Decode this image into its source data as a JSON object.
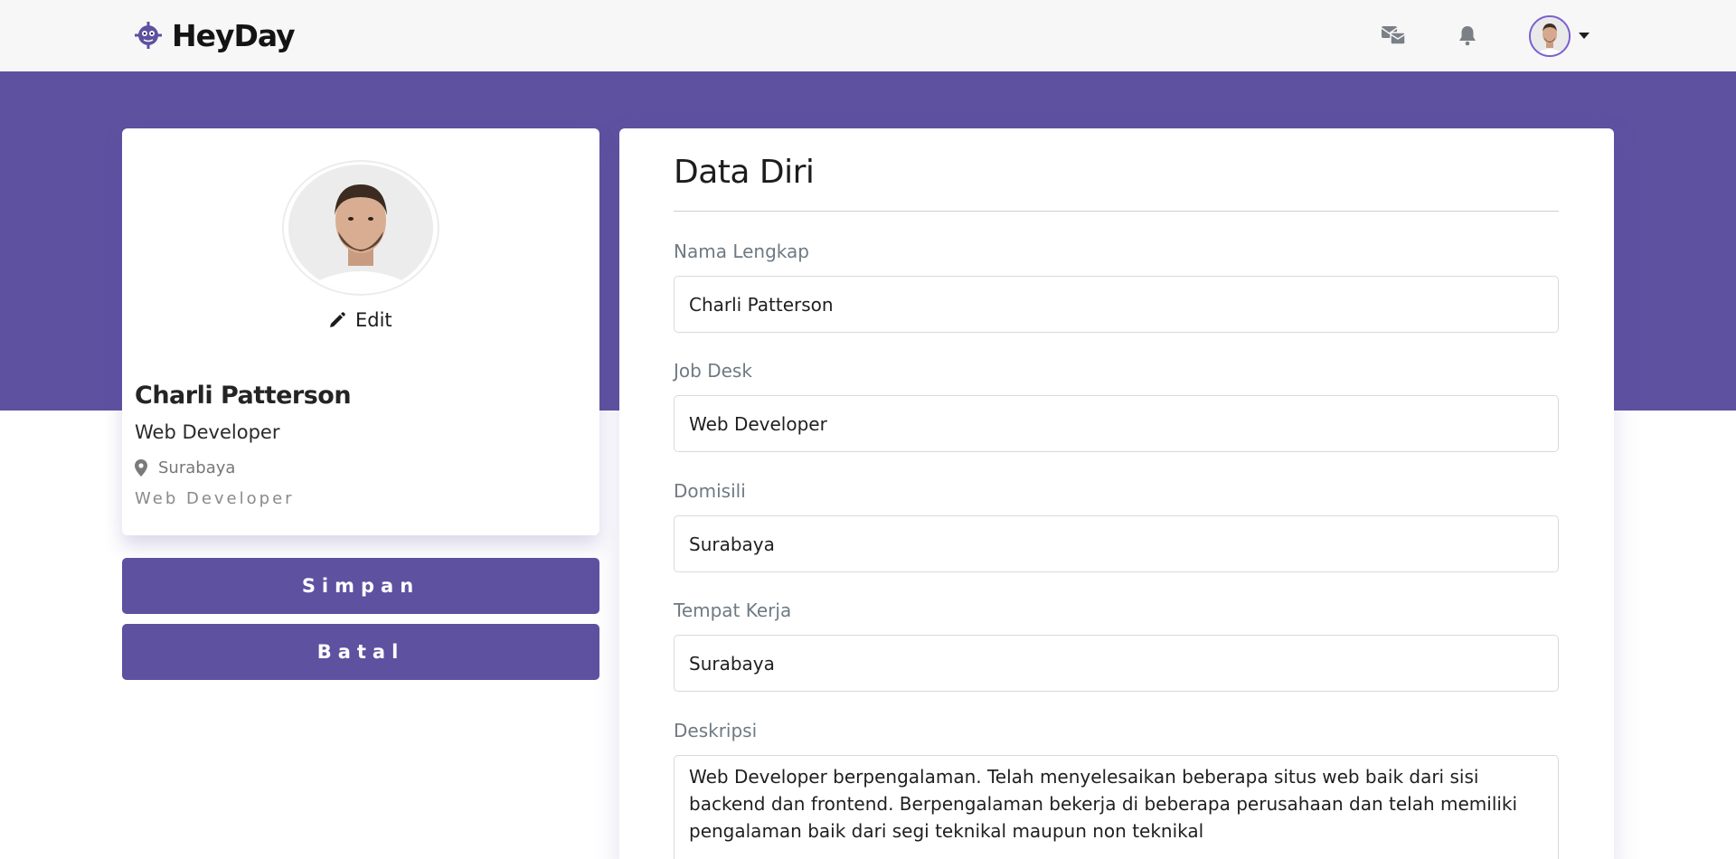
{
  "app": {
    "brand_name": "HeyDay"
  },
  "navbar": {
    "icons": [
      "mail-bulk-icon",
      "bell-icon",
      "user-avatar",
      "caret-down-icon"
    ]
  },
  "profile_card": {
    "edit_label": "Edit",
    "name": "Charli Patterson",
    "role": "Web Developer",
    "location": "Surabaya",
    "tagline": "Web Developer"
  },
  "actions": {
    "save_label": "Simpan",
    "cancel_label": "Batal"
  },
  "form": {
    "title": "Data Diri",
    "fields": {
      "full_name": {
        "label": "Nama Lengkap",
        "value": "Charli Patterson"
      },
      "job_desk": {
        "label": "Job Desk",
        "value": "Web Developer"
      },
      "domicile": {
        "label": "Domisili",
        "value": "Surabaya"
      },
      "workplace": {
        "label": "Tempat Kerja",
        "value": "Surabaya"
      },
      "description": {
        "label": "Deskripsi",
        "value": "Web Developer berpengalaman. Telah menyelesaikan beberapa situs web baik dari sisi backend dan frontend. Berpengalaman bekerja di beberapa perusahaan dan telah memiliki pengalaman baik dari segi teknikal maupun non teknikal"
      }
    }
  },
  "colors": {
    "primary": "#5e51a0",
    "navbar_bg": "#f7f7f8",
    "label": "#6e7a83"
  }
}
